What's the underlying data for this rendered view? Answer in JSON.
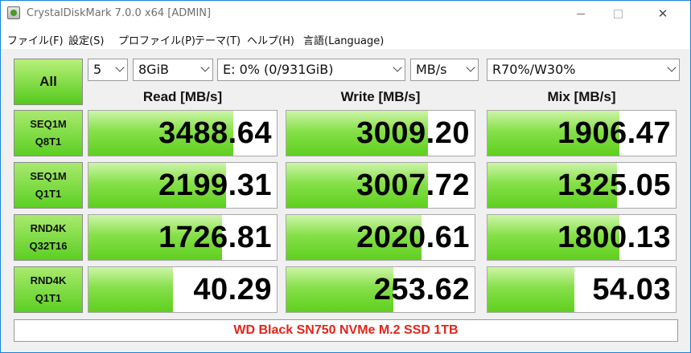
{
  "window": {
    "title": "CrystalDiskMark 7.0.0 x64 [ADMIN]"
  },
  "menu": [
    {
      "label": "ファイル(F)"
    },
    {
      "label": "設定(S)"
    },
    {
      "label": "プロファイル(P)"
    },
    {
      "label": "テーマ(T)"
    },
    {
      "label": "ヘルプ(H)"
    },
    {
      "label": "言語(Language)"
    }
  ],
  "controls": {
    "all_label": "All",
    "count": "5",
    "size": "8GiB",
    "drive": "E: 0% (0/931GiB)",
    "unit": "MB/s",
    "mix": "R70%/W30%"
  },
  "headers": {
    "read": "Read [MB/s]",
    "write": "Write [MB/s]",
    "mix": "Mix [MB/s]"
  },
  "rows": [
    {
      "line1": "SEQ1M",
      "line2": "Q8T1",
      "read": "3488.64",
      "write": "3009.20",
      "mix": "1906.47",
      "read_fill": 0.77,
      "write_fill": 0.75,
      "mix_fill": 0.7
    },
    {
      "line1": "SEQ1M",
      "line2": "Q1T1",
      "read": "2199.31",
      "write": "3007.72",
      "mix": "1325.05",
      "read_fill": 0.73,
      "write_fill": 0.75,
      "mix_fill": 0.69
    },
    {
      "line1": "RND4K",
      "line2": "Q32T16",
      "read": "1726.81",
      "write": "2020.61",
      "mix": "1800.13",
      "read_fill": 0.71,
      "write_fill": 0.72,
      "mix_fill": 0.7
    },
    {
      "line1": "RND4K",
      "line2": "Q1T1",
      "read": "40.29",
      "write": "253.62",
      "mix": "54.03",
      "read_fill": 0.45,
      "write_fill": 0.57,
      "mix_fill": 0.46
    }
  ],
  "comment": "WD Black SN750 NVMe M.2 SSD 1TB",
  "colors": {
    "accent_green": "#5fcf1e",
    "comment_red": "#e1251b",
    "window_border": "#1883d7"
  }
}
